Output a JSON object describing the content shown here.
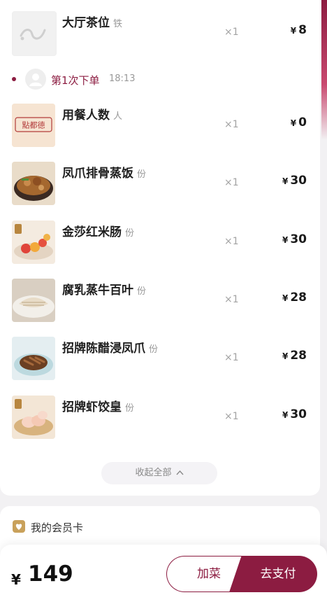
{
  "order": {
    "top_item": {
      "name": "大厅茶位",
      "unit": "铁",
      "qty": "×1",
      "price": "8",
      "currency": "¥",
      "thumb": "squiggle-placeholder-icon"
    },
    "round": {
      "label": "第1次下单",
      "time": "18:13",
      "avatar": "user-avatar-icon"
    },
    "items": [
      {
        "name": "用餐人数",
        "unit": "人",
        "qty": "×1",
        "price": "0",
        "currency": "¥",
        "thumb": "restaurant-logo"
      },
      {
        "name": "凤爪排骨蒸饭",
        "unit": "份",
        "qty": "×1",
        "price": "30",
        "currency": "¥",
        "thumb": "claypot-rice-photo"
      },
      {
        "name": "金莎红米肠",
        "unit": "份",
        "qty": "×1",
        "price": "30",
        "currency": "¥",
        "thumb": "rice-roll-photo"
      },
      {
        "name": "腐乳蒸牛百叶",
        "unit": "份",
        "qty": "×1",
        "price": "28",
        "currency": "¥",
        "thumb": "tripe-photo"
      },
      {
        "name": "招牌陈醋浸凤爪",
        "unit": "份",
        "qty": "×1",
        "price": "28",
        "currency": "¥",
        "thumb": "chicken-feet-photo"
      },
      {
        "name": "招牌虾饺皇",
        "unit": "份",
        "qty": "×1",
        "price": "30",
        "currency": "¥",
        "thumb": "shrimp-dumpling-photo"
      }
    ],
    "collapse_label": "收起全部",
    "collapse_icon": "chevron-up-icon"
  },
  "logo_text": "點都德",
  "member": {
    "label": "我的会员卡",
    "icon": "heart-badge-icon"
  },
  "footer": {
    "currency": "¥",
    "total": "149",
    "add_label": "加菜",
    "pay_label": "去支付"
  },
  "colors": {
    "brand": "#8c1c41",
    "muted": "#999999"
  }
}
